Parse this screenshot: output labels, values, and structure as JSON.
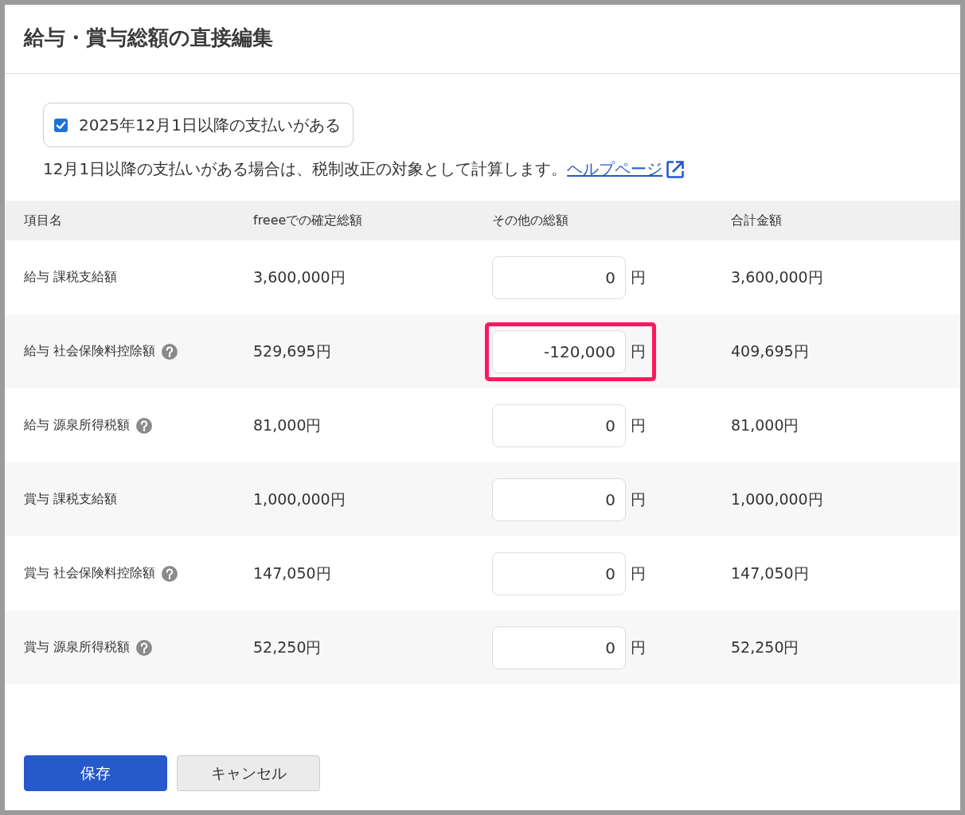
{
  "dialog": {
    "title": "給与・賞与総額の直接編集"
  },
  "checkbox": {
    "label": "2025年12月1日以降の支払いがある",
    "checked": true
  },
  "note": {
    "text": "12月1日以降の支払いがある場合は、税制改正の対象として計算します。",
    "link": "ヘルプページ"
  },
  "table": {
    "columns": [
      "項目名",
      "freeeでの確定総額",
      "その他の総額",
      "合計金額"
    ],
    "rows": [
      {
        "name": "給与 課税支給額",
        "help": false,
        "confirmed": "3,600,000円",
        "other": "0",
        "unit": "円",
        "total": "3,600,000円",
        "highlighted": false
      },
      {
        "name": "給与 社会保険料控除額",
        "help": true,
        "confirmed": "529,695円",
        "other": "-120,000",
        "unit": "円",
        "total": "409,695円",
        "highlighted": true
      },
      {
        "name": "給与 源泉所得税額",
        "help": true,
        "confirmed": "81,000円",
        "other": "0",
        "unit": "円",
        "total": "81,000円",
        "highlighted": false
      },
      {
        "name": "賞与 課税支給額",
        "help": false,
        "confirmed": "1,000,000円",
        "other": "0",
        "unit": "円",
        "total": "1,000,000円",
        "highlighted": false
      },
      {
        "name": "賞与 社会保険料控除額",
        "help": true,
        "confirmed": "147,050円",
        "other": "0",
        "unit": "円",
        "total": "147,050円",
        "highlighted": false
      },
      {
        "name": "賞与 源泉所得税額",
        "help": true,
        "confirmed": "52,250円",
        "other": "0",
        "unit": "円",
        "total": "52,250円",
        "highlighted": false
      }
    ]
  },
  "buttons": [
    {
      "label": "保存",
      "kind": "primary"
    },
    {
      "label": "キャンセル",
      "kind": "secondary"
    }
  ]
}
